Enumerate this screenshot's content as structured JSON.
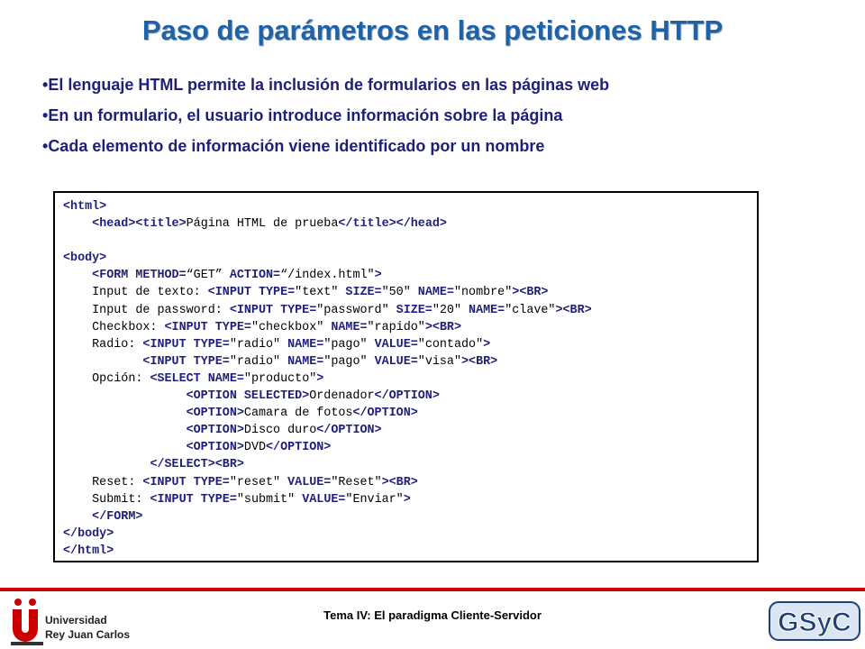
{
  "title": "Paso de parámetros en las peticiones HTTP",
  "bullets": [
    "El lenguaje HTML permite la inclusión de formularios en las páginas web",
    "En un formulario, el usuario introduce información sobre la página",
    "Cada elemento de información viene identificado por un nombre"
  ],
  "code_lines": [
    "<html>",
    "    <head><title>Página HTML de prueba</title></head>",
    "",
    "<body>",
    "    <FORM METHOD=“GET” ACTION=“/index.html\">",
    "    Input de texto: <INPUT TYPE=\"text\" SIZE=\"50\" NAME=\"nombre\"><BR>",
    "    Input de password: <INPUT TYPE=\"password\" SIZE=\"20\" NAME=\"clave\"><BR>",
    "    Checkbox: <INPUT TYPE=\"checkbox\" NAME=\"rapido\"><BR>",
    "    Radio: <INPUT TYPE=\"radio\" NAME=\"pago\" VALUE=\"contado\">",
    "           <INPUT TYPE=\"radio\" NAME=\"pago\" VALUE=\"visa\"><BR>",
    "    Opción: <SELECT NAME=\"producto\">",
    "                 <OPTION SELECTED>Ordenador</OPTION>",
    "                 <OPTION>Camara de fotos</OPTION>",
    "                 <OPTION>Disco duro</OPTION>",
    "                 <OPTION>DVD</OPTION>",
    "            </SELECT><BR>",
    "    Reset: <INPUT TYPE=\"reset\" VALUE=\"Reset\"><BR>",
    "    Submit: <INPUT TYPE=\"submit\" VALUE=\"Enviar\">",
    "    </FORM>",
    "</body>",
    "</html>"
  ],
  "footer": {
    "text": "Tema IV: El paradigma Cliente-Servidor",
    "university_line1": "Universidad",
    "university_line2": "Rey Juan Carlos",
    "logo_right": "GSyC"
  },
  "colors": {
    "title": "#1f62a6",
    "bullet_text": "#1f1f7a",
    "footer_rule": "#cc0000"
  }
}
